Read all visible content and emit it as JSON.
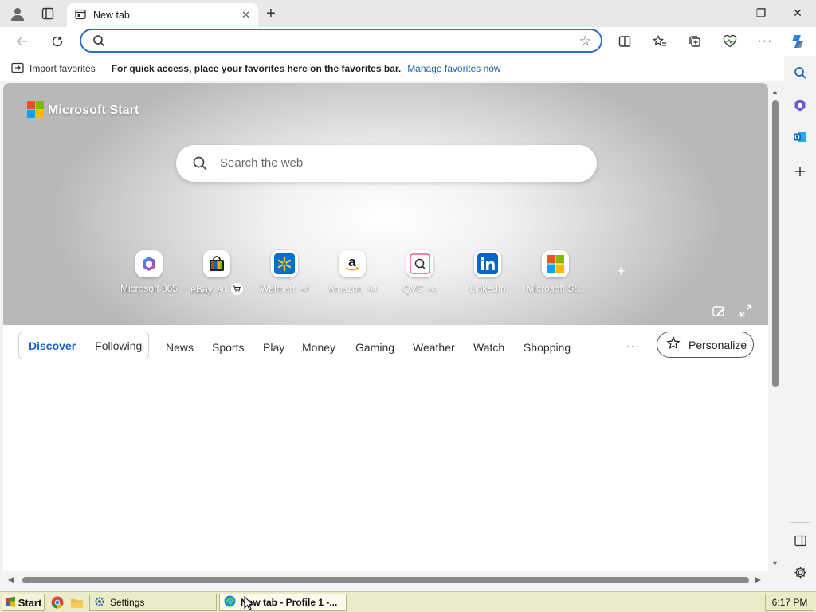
{
  "browser": {
    "tab": {
      "title": "New tab",
      "icon": "new-tab-page-icon"
    },
    "window_controls": {
      "minimize": "—",
      "restore": "❐",
      "close": "✕"
    },
    "toolbar": {
      "back_icon": "back-arrow-icon",
      "refresh_icon": "refresh-icon",
      "address_value": "",
      "favorite_star": "☆"
    }
  },
  "favorites_bar": {
    "import_label": "Import favorites",
    "message": "For quick access, place your favorites here on the favorites bar.",
    "manage_link": "Manage favorites now"
  },
  "start_page": {
    "brand": "Microsoft Start",
    "search_placeholder": "Search the web",
    "quick_links": [
      {
        "label": "Microsoft 365",
        "ad": "",
        "icon": "m365-icon"
      },
      {
        "label": "eBay",
        "ad": "Ad",
        "icon": "ebay-icon"
      },
      {
        "label": "Walmart",
        "ad": "Ad",
        "icon": "walmart-icon"
      },
      {
        "label": "Amazon",
        "ad": "Ad",
        "icon": "amazon-icon"
      },
      {
        "label": "QVC",
        "ad": "Ad",
        "icon": "qvc-icon"
      },
      {
        "label": "LinkedIn",
        "ad": "",
        "icon": "linkedin-icon"
      },
      {
        "label": "Microsoft St...",
        "ad": "",
        "icon": "microsoft-store-icon"
      }
    ],
    "add_link": "+",
    "feed_toggle": {
      "discover": "Discover",
      "following": "Following"
    },
    "categories": [
      "News",
      "Sports",
      "Play",
      "Money",
      "Gaming",
      "Weather",
      "Watch",
      "Shopping"
    ],
    "more": "···",
    "personalize": "Personalize"
  },
  "taskbar": {
    "start": "Start",
    "items": [
      {
        "label": "Settings"
      },
      {
        "label": "New tab - Profile 1 -..."
      }
    ],
    "clock": "6:17 PM"
  },
  "colors": {
    "accent": "#1a64c8",
    "link": "#1a5fb4",
    "address_border": "#2b6ccf",
    "taskbar": "#ecebc8"
  }
}
